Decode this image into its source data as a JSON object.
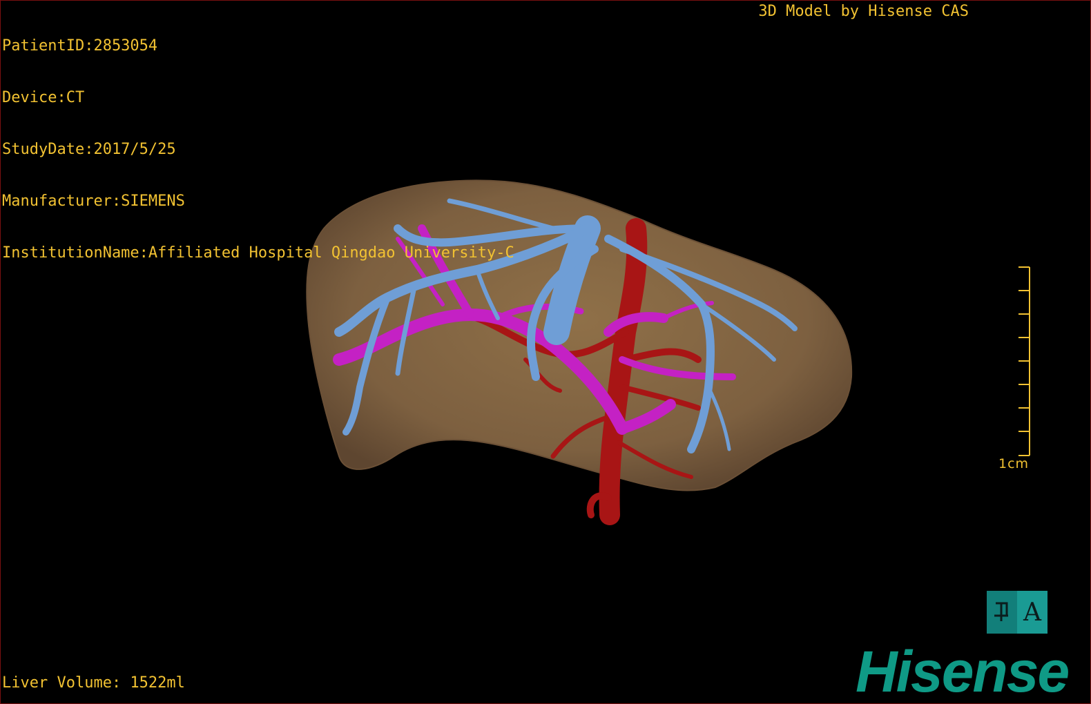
{
  "header": {
    "patient_id": "PatientID:2853054",
    "device": "Device:CT",
    "study_date": "StudyDate:2017/5/25",
    "manufacturer": "Manufacturer:SIEMENS",
    "institution": "InstitutionName:Affiliated Hospital Qingdao University-C",
    "model_credit": "3D Model by Hisense CAS"
  },
  "footer": {
    "liver_volume": "Liver Volume: 1522ml"
  },
  "scale": {
    "label": "1cm",
    "tick_count": 9
  },
  "view_toggle": {
    "left_icon": "flip-icon",
    "right_label": "A"
  },
  "logo": {
    "text": "Hisense"
  },
  "colors": {
    "overlay_text": "#f2c232",
    "liver": "#8a6c45",
    "hepatic_vein": "#6f9ed6",
    "portal_vein": "#c421c4",
    "artery": "#a81515",
    "brand": "#0f9a86"
  }
}
